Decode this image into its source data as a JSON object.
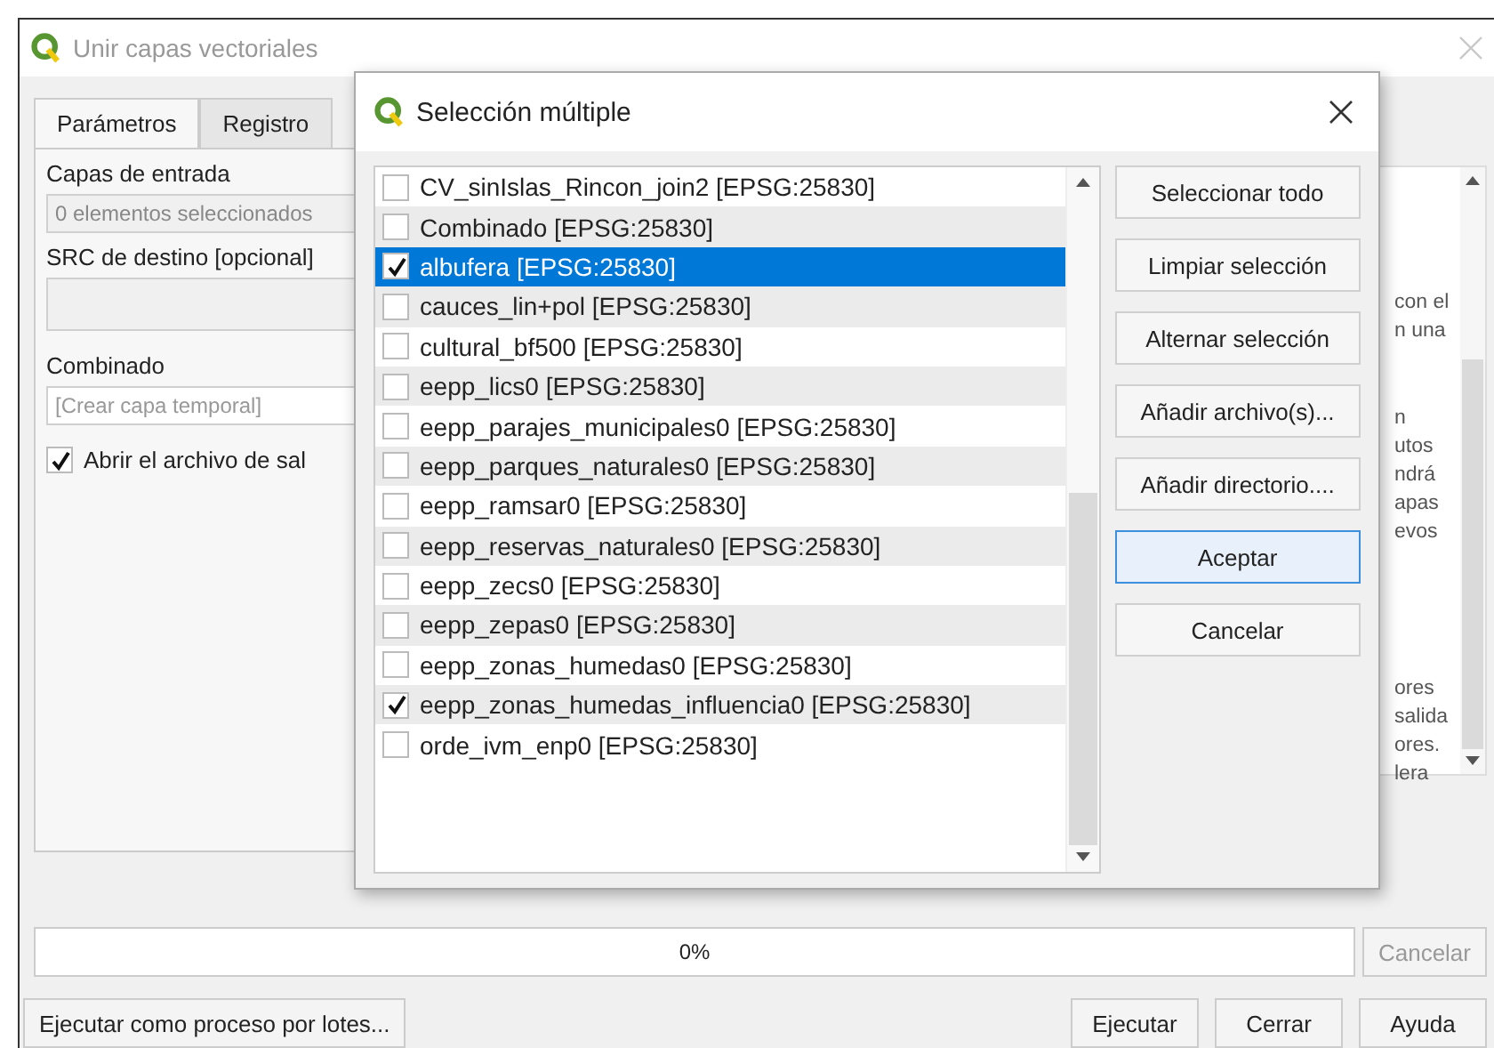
{
  "window": {
    "title": "Unir capas vectoriales"
  },
  "tabs": [
    {
      "label": "Parámetros",
      "selected": true
    },
    {
      "label": "Registro",
      "selected": false
    }
  ],
  "parameters": {
    "input_label": "Capas de entrada",
    "input_value": "0 elementos seleccionados",
    "crs_label": "SRC de destino [opcional]",
    "output_label": "Combinado",
    "output_placeholder": "[Crear capa temporal]",
    "open_output": {
      "label": "Abrir el archivo de sal",
      "checked": true
    }
  },
  "help_panel": {
    "paragraphs": [
      [
        "con el",
        "n una"
      ],
      [
        "n",
        "utos",
        "ndrá",
        "apas",
        "evos"
      ],
      [
        "ores",
        "salida",
        "ores.",
        "lera"
      ]
    ]
  },
  "dialog": {
    "title": "Selección múltiple",
    "items": [
      {
        "label": "CV_sinIslas_Rincon_join2 [EPSG:25830]",
        "checked": false,
        "selected": false
      },
      {
        "label": "Combinado [EPSG:25830]",
        "checked": false,
        "selected": false
      },
      {
        "label": "albufera [EPSG:25830]",
        "checked": true,
        "selected": true
      },
      {
        "label": "cauces_lin+pol [EPSG:25830]",
        "checked": false,
        "selected": false
      },
      {
        "label": "cultural_bf500 [EPSG:25830]",
        "checked": false,
        "selected": false
      },
      {
        "label": "eepp_lics0 [EPSG:25830]",
        "checked": false,
        "selected": false
      },
      {
        "label": "eepp_parajes_municipales0 [EPSG:25830]",
        "checked": false,
        "selected": false
      },
      {
        "label": "eepp_parques_naturales0 [EPSG:25830]",
        "checked": false,
        "selected": false
      },
      {
        "label": "eepp_ramsar0 [EPSG:25830]",
        "checked": false,
        "selected": false
      },
      {
        "label": "eepp_reservas_naturales0 [EPSG:25830]",
        "checked": false,
        "selected": false
      },
      {
        "label": "eepp_zecs0 [EPSG:25830]",
        "checked": false,
        "selected": false
      },
      {
        "label": "eepp_zepas0 [EPSG:25830]",
        "checked": false,
        "selected": false
      },
      {
        "label": "eepp_zonas_humedas0 [EPSG:25830]",
        "checked": false,
        "selected": false
      },
      {
        "label": "eepp_zonas_humedas_influencia0 [EPSG:25830]",
        "checked": true,
        "selected": false
      },
      {
        "label": "orde_ivm_enp0 [EPSG:25830]",
        "checked": false,
        "selected": false
      }
    ],
    "buttons": [
      {
        "label": "Seleccionar todo",
        "default": false
      },
      {
        "label": "Limpiar selección",
        "default": false
      },
      {
        "label": "Alternar selección",
        "default": false
      },
      {
        "label": "Añadir archivo(s)...",
        "default": false
      },
      {
        "label": "Añadir directorio....",
        "default": false
      },
      {
        "label": "Aceptar",
        "default": true
      },
      {
        "label": "Cancelar",
        "default": false
      }
    ]
  },
  "progress": {
    "text": "0%",
    "level": 0,
    "cancel": {
      "label": "Cancelar",
      "disabled": true
    }
  },
  "footer": {
    "batch_button": "Ejecutar como proceso por lotes...",
    "buttons": [
      "Ejecutar",
      "Cerrar",
      "Ayuda"
    ]
  }
}
